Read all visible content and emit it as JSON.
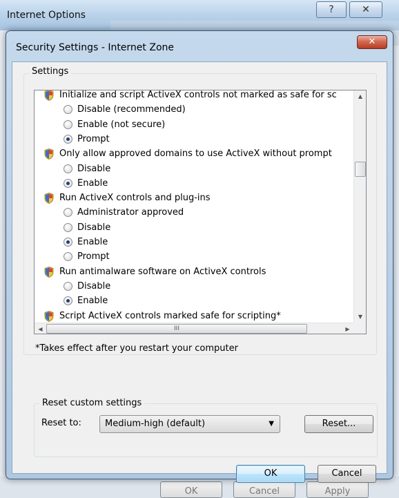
{
  "background_window": {
    "title": "Internet Options",
    "help_label": "?",
    "close_label": "✕",
    "bottom_buttons": [
      "OK",
      "Cancel",
      "Apply"
    ]
  },
  "dialog": {
    "title": "Security Settings - Internet Zone",
    "close_label": "✕"
  },
  "settings": {
    "group_label": "Settings",
    "items": [
      {
        "kind": "heading",
        "label": "Initialize and script ActiveX controls not marked as safe for sc"
      },
      {
        "kind": "option",
        "label": "Disable (recommended)",
        "checked": false
      },
      {
        "kind": "option",
        "label": "Enable (not secure)",
        "checked": false
      },
      {
        "kind": "option",
        "label": "Prompt",
        "checked": true
      },
      {
        "kind": "heading",
        "label": "Only allow approved domains to use ActiveX without prompt"
      },
      {
        "kind": "option",
        "label": "Disable",
        "checked": false
      },
      {
        "kind": "option",
        "label": "Enable",
        "checked": true
      },
      {
        "kind": "heading",
        "label": "Run ActiveX controls and plug-ins"
      },
      {
        "kind": "option",
        "label": "Administrator approved",
        "checked": false
      },
      {
        "kind": "option",
        "label": "Disable",
        "checked": false
      },
      {
        "kind": "option",
        "label": "Enable",
        "checked": true
      },
      {
        "kind": "option",
        "label": "Prompt",
        "checked": false
      },
      {
        "kind": "heading",
        "label": "Run antimalware software on ActiveX controls"
      },
      {
        "kind": "option",
        "label": "Disable",
        "checked": false
      },
      {
        "kind": "option",
        "label": "Enable",
        "checked": true
      },
      {
        "kind": "heading",
        "label": "Script ActiveX controls marked safe for scripting*"
      }
    ],
    "footnote": "*Takes effect after you restart your computer",
    "hscroll_grip": "III"
  },
  "reset": {
    "group_label": "Reset custom settings",
    "reset_to_label": "Reset to:",
    "selected_level": "Medium-high (default)",
    "reset_button": "Reset..."
  },
  "buttons": {
    "ok": "OK",
    "cancel": "Cancel"
  },
  "colors": {
    "checked_radio": "#1d3f7a",
    "close_button": "#c8452b",
    "ok_focus_border": "#3c7fb1"
  }
}
